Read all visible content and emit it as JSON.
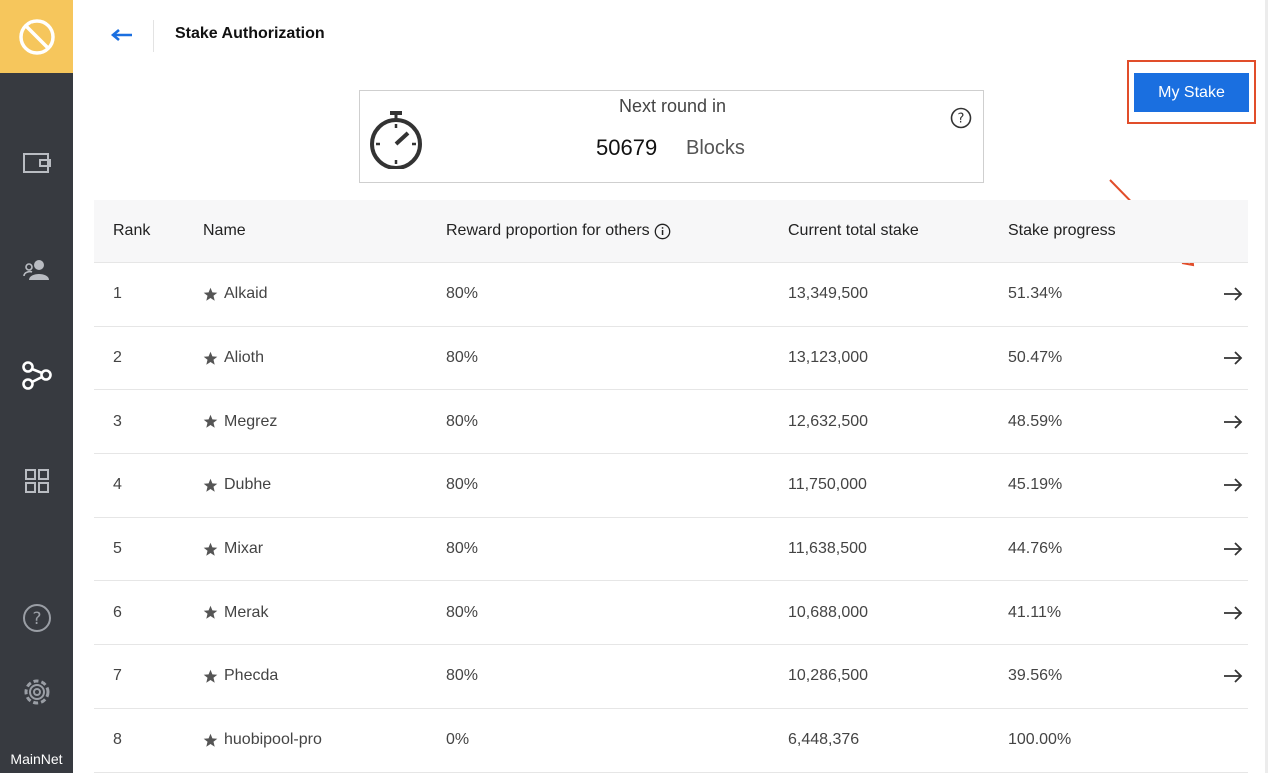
{
  "sidebar": {
    "network": "MainNet",
    "items": [
      {
        "icon": "wallet-icon"
      },
      {
        "icon": "contacts-icon"
      },
      {
        "icon": "node-stake-icon"
      },
      {
        "icon": "apps-grid-icon"
      },
      {
        "icon": "help-icon"
      },
      {
        "icon": "settings-icon"
      }
    ]
  },
  "header": {
    "title": "Stake Authorization"
  },
  "round": {
    "label": "Next round in",
    "count": "50679",
    "unit": "Blocks"
  },
  "my_stake_label": "My Stake",
  "table": {
    "headers": {
      "rank": "Rank",
      "name": "Name",
      "reward": "Reward proportion for others",
      "total": "Current total stake",
      "progress": "Stake progress"
    },
    "rows": [
      {
        "rank": "1",
        "name": "Alkaid",
        "reward": "80%",
        "total": "13,349,500",
        "progress": "51.34%"
      },
      {
        "rank": "2",
        "name": "Alioth",
        "reward": "80%",
        "total": "13,123,000",
        "progress": "50.47%"
      },
      {
        "rank": "3",
        "name": "Megrez",
        "reward": "80%",
        "total": "12,632,500",
        "progress": "48.59%"
      },
      {
        "rank": "4",
        "name": "Dubhe",
        "reward": "80%",
        "total": "11,750,000",
        "progress": "45.19%"
      },
      {
        "rank": "5",
        "name": "Mixar",
        "reward": "80%",
        "total": "11,638,500",
        "progress": "44.76%"
      },
      {
        "rank": "6",
        "name": "Merak",
        "reward": "80%",
        "total": "10,688,000",
        "progress": "41.11%"
      },
      {
        "rank": "7",
        "name": "Phecda",
        "reward": "80%",
        "total": "10,286,500",
        "progress": "39.56%"
      },
      {
        "rank": "8",
        "name": "huobipool-pro",
        "reward": "0%",
        "total": "6,448,376",
        "progress": "100.00%"
      }
    ]
  },
  "colors": {
    "sidebar_bg": "#373a40",
    "logo_bg": "#f6c65c",
    "primary": "#1a6fe0",
    "annotation": "#e14d2a"
  }
}
